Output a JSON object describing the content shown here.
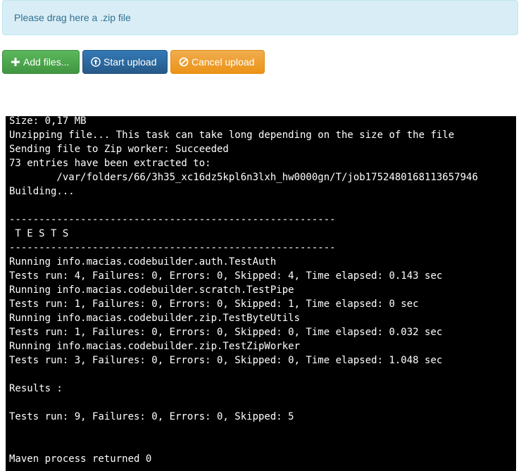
{
  "dropzone": {
    "text": "Please drag here a .zip file"
  },
  "toolbar": {
    "add_files_label": "Add files...",
    "start_upload_label": "Start upload",
    "cancel_upload_label": "Cancel upload",
    "add_icon": "plus-icon",
    "start_icon": "upload-circle-icon",
    "cancel_icon": "ban-icon"
  },
  "console": {
    "lines": [
      "Size: 0,17 MB",
      "Unzipping file... This task can take long depending on the size of the file",
      "Sending file to Zip worker: Succeeded",
      "73 entries have been extracted to:",
      "        /var/folders/66/3h35_xc16dz5kpl6n3lxh_hw0000gn/T/job1752480168113657946",
      "Building...",
      "",
      "-------------------------------------------------------",
      " T E S T S",
      "-------------------------------------------------------",
      "Running info.macias.codebuilder.auth.TestAuth",
      "Tests run: 4, Failures: 0, Errors: 0, Skipped: 4, Time elapsed: 0.143 sec",
      "Running info.macias.codebuilder.scratch.TestPipe",
      "Tests run: 1, Failures: 0, Errors: 0, Skipped: 1, Time elapsed: 0 sec",
      "Running info.macias.codebuilder.zip.TestByteUtils",
      "Tests run: 1, Failures: 0, Errors: 0, Skipped: 0, Time elapsed: 0.032 sec",
      "Running info.macias.codebuilder.zip.TestZipWorker",
      "Tests run: 3, Failures: 0, Errors: 0, Skipped: 0, Time elapsed: 1.048 sec",
      "",
      "Results :",
      "",
      "Tests run: 9, Failures: 0, Errors: 0, Skipped: 5",
      "",
      "",
      "Maven process returned 0"
    ]
  },
  "colors": {
    "add": "#5cb85c",
    "start": "#337ab7",
    "cancel": "#f0ad4e",
    "dropzone_bg": "#d9edf7",
    "dropzone_text": "#31708f",
    "console_bg": "#000000",
    "console_text": "#ffffff"
  }
}
